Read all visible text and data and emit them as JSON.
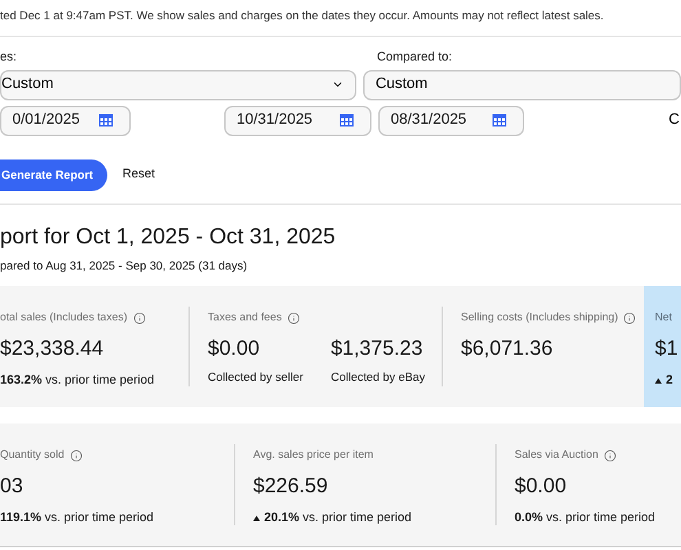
{
  "notice": "ted Dec 1 at 9:47am PST. We show sales and charges on the dates they occur. Amounts may not reflect latest sales.",
  "filters": {
    "primary_label": "es:",
    "primary_select": "Custom",
    "compare_label": "Compared to:",
    "compare_select": "Custom",
    "dates": [
      "0/01/2025",
      "10/31/2025",
      "08/31/2025"
    ],
    "cut_text": "C"
  },
  "actions": {
    "generate": "Generate Report",
    "reset": "Reset"
  },
  "report": {
    "title": "port for Oct 1, 2025 - Oct 31, 2025",
    "subtitle": "pared to Aug 31, 2025 - Sep 30, 2025 (31 days)"
  },
  "summary_cards": [
    {
      "metrics": [
        {
          "label": "otal sales (Includes taxes)",
          "info": true,
          "highlighted": false,
          "values": [
            {
              "amount": "$23,338.44"
            }
          ],
          "change": {
            "rising": false,
            "percent": "163.2%",
            "text": "vs. prior time period"
          }
        },
        {
          "label": "Taxes and fees",
          "info": true,
          "highlighted": false,
          "values": [
            {
              "amount": "$0.00",
              "caption": "Collected by seller"
            },
            {
              "amount": "$1,375.23",
              "caption": "Collected by eBay"
            }
          ]
        },
        {
          "label": "Selling costs (Includes shipping)",
          "info": true,
          "highlighted": false,
          "values": [
            {
              "amount": "$6,071.36"
            }
          ]
        },
        {
          "label": "Net",
          "info": false,
          "highlighted": true,
          "values": [
            {
              "amount": "$1"
            }
          ],
          "change": {
            "rising": true,
            "percent": "2"
          }
        }
      ]
    },
    {
      "metrics": [
        {
          "label": "Quantity sold",
          "info": true,
          "highlighted": false,
          "values": [
            {
              "amount": "03"
            }
          ],
          "change": {
            "rising": false,
            "percent": "119.1%",
            "text": "vs. prior time period"
          }
        },
        {
          "label": "Avg. sales price per item",
          "info": false,
          "highlighted": false,
          "values": [
            {
              "amount": "$226.59"
            }
          ],
          "change": {
            "rising": true,
            "percent": "20.1%",
            "text": "vs. prior time period"
          }
        },
        {
          "label": "Sales via Auction",
          "info": true,
          "highlighted": false,
          "values": [
            {
              "amount": "$0.00"
            }
          ],
          "change": {
            "rising": false,
            "percent": "0.0%",
            "text": "vs. prior time period"
          }
        }
      ]
    }
  ]
}
